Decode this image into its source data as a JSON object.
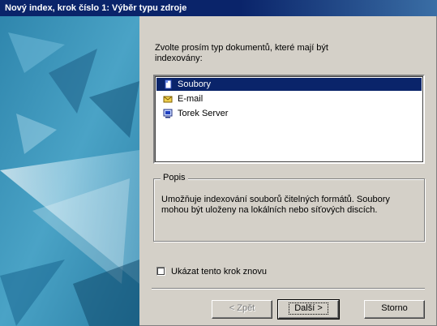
{
  "window": {
    "title": "Nový index, krok číslo 1: Výběr typu zdroje"
  },
  "instruction": "Zvolte prosím typ dokumentů, které mají být indexovány:",
  "document_types": [
    {
      "label": "Soubory",
      "icon": "file-icon",
      "selected": true
    },
    {
      "label": "E-mail",
      "icon": "mail-icon",
      "selected": false
    },
    {
      "label": "Torek Server",
      "icon": "server-icon",
      "selected": false
    }
  ],
  "description": {
    "legend": "Popis",
    "text": "Umožňuje indexování souborů čitelných formátů. Soubory mohou být uloženy na lokálních nebo síťových discích."
  },
  "checkbox": {
    "label": "Ukázat tento krok znovu",
    "checked": false
  },
  "buttons": {
    "back": "< Zpět",
    "next": "Další >",
    "cancel": "Storno"
  },
  "colors": {
    "titlebar": "#0a246a",
    "selection": "#0a246a",
    "dialog": "#d4d0c8",
    "banner": "#3e95bb"
  }
}
